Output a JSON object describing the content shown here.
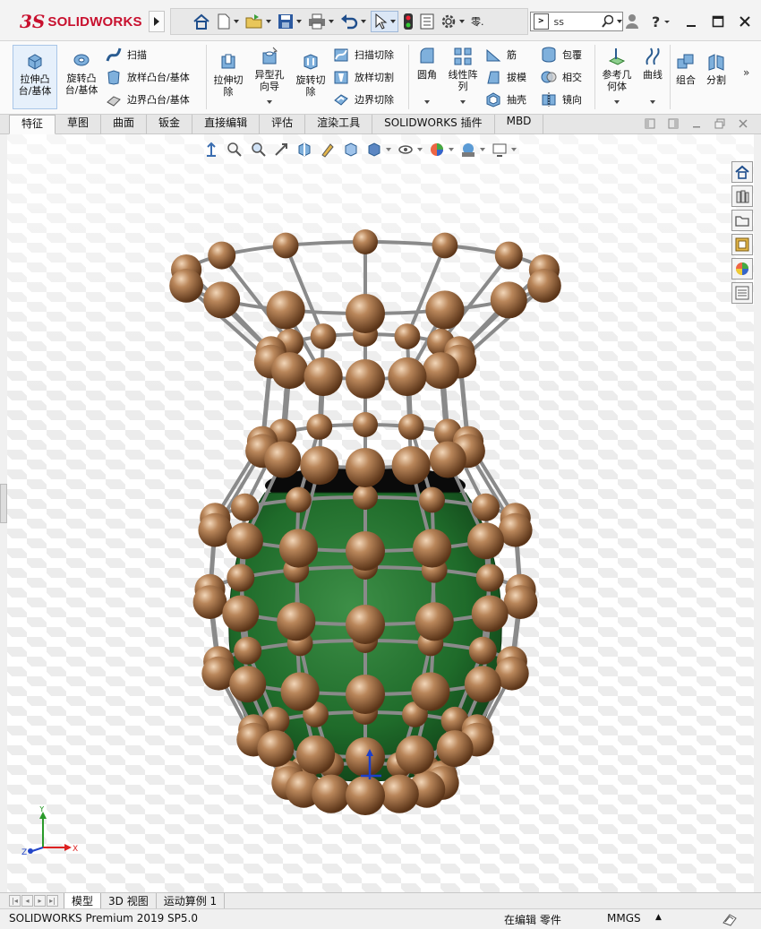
{
  "app": {
    "logo_prefix": "3S",
    "logo_name": "SOLIDWORKS"
  },
  "quick_access": {
    "items": [
      "home-icon",
      "new-document-icon",
      "open-icon",
      "save-icon",
      "print-icon",
      "undo-icon",
      "select-icon",
      "rebuild-icon",
      "file-properties-icon",
      "options-icon"
    ],
    "overflow_label": "零."
  },
  "search": {
    "value": "ss"
  },
  "ribbon": {
    "extrude_boss": "拉伸凸\n台/基体",
    "revolve_boss": "旋转凸\n台/基体",
    "sweep": "扫描",
    "loft_boss": "放样凸台/基体",
    "boundary_boss": "边界凸台/基体",
    "extrude_cut": "拉伸切\n除",
    "hole_wizard": "异型孔\n向导",
    "revolve_cut": "旋转切\n除",
    "swept_cut": "扫描切除",
    "lofted_cut": "放样切割",
    "boundary_cut": "边界切除",
    "fillet": "圆角",
    "linear_pattern": "线性阵\n列",
    "rib": "筋",
    "draft": "拔模",
    "shell": "抽壳",
    "wrap": "包覆",
    "intersect": "相交",
    "mirror": "镜向",
    "reference_geometry": "参考几\n何体",
    "curves": "曲线",
    "combine": "组合",
    "split": "分割"
  },
  "tabs": {
    "items": [
      "特征",
      "草图",
      "曲面",
      "钣金",
      "直接编辑",
      "评估",
      "渲染工具",
      "SOLIDWORKS 插件",
      "MBD"
    ],
    "active": "特征"
  },
  "heads_up_toolbar": {
    "items": [
      "view-orientation-icon",
      "zoom-to-fit-icon",
      "zoom-to-area-icon",
      "previous-view-icon",
      "section-view-icon",
      "dynamic-annotation-icon",
      "view-orientation-cube-icon",
      "display-style-icon",
      "hide-show-items-icon",
      "edit-appearance-icon",
      "apply-scene-icon",
      "view-settings-icon"
    ]
  },
  "task_pane": {
    "items": [
      "solidworks-resources-icon",
      "design-library-icon",
      "file-explorer-icon",
      "view-palette-icon",
      "appearances-icon",
      "custom-properties-icon"
    ]
  },
  "triad": {
    "x_label": "X",
    "y_label": "Y",
    "z_label": "Z"
  },
  "model": {
    "cage_color": "#8a8a8a",
    "ball_color": "#b07a4c",
    "vase_color": "#1f6b2a"
  },
  "bottom_tabs": {
    "items": [
      "模型",
      "3D 视图",
      "运动算例 1"
    ],
    "active": "模型"
  },
  "status": {
    "product": "SOLIDWORKS Premium 2019 SP5.0",
    "mode": "在编辑 零件",
    "units": "MMGS",
    "units_caret": "▲"
  }
}
